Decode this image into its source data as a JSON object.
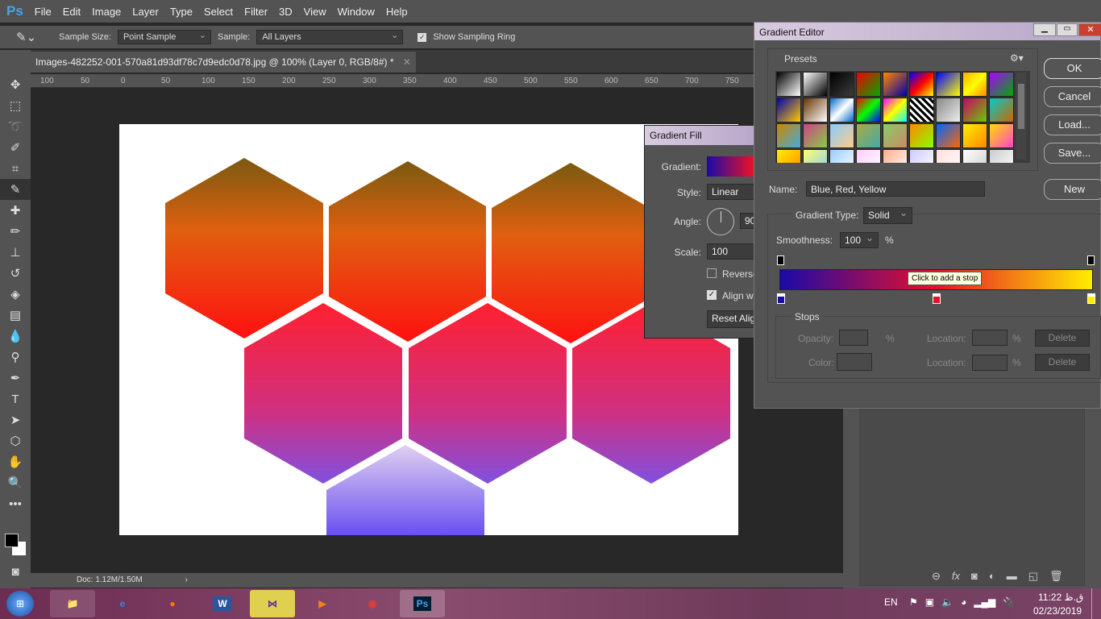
{
  "app": {
    "logo": "Ps",
    "menu": [
      "File",
      "Edit",
      "Image",
      "Layer",
      "Type",
      "Select",
      "Filter",
      "3D",
      "View",
      "Window",
      "Help"
    ]
  },
  "options": {
    "sample_size_label": "Sample Size:",
    "sample_size": "Point Sample",
    "sample_label": "Sample:",
    "sample": "All Layers",
    "show_ring": "Show Sampling Ring",
    "show_ring_checked": true
  },
  "document": {
    "tab": "Images-482252-001-570a81d93df78c7d9edc0d78.jpg @ 100% (Layer 0, RGB/8#) *",
    "ruler": [
      "100",
      "50",
      "0",
      "50",
      "100",
      "150",
      "200",
      "250",
      "300",
      "350",
      "400",
      "450",
      "500",
      "550",
      "600",
      "650",
      "700",
      "750"
    ],
    "status": "Doc: 1.12M/1.50M"
  },
  "gradient_fill": {
    "title": "Gradient Fill",
    "gradient_label": "Gradient:",
    "style_label": "Style:",
    "style": "Linear",
    "angle_label": "Angle:",
    "angle": "90",
    "scale_label": "Scale:",
    "scale": "100",
    "reverse": "Reverse",
    "reverse_checked": false,
    "align": "Align with layer",
    "align_checked": true,
    "reset": "Reset Alignment"
  },
  "gradient_editor": {
    "title": "Gradient Editor",
    "presets_label": "Presets",
    "ok": "OK",
    "cancel": "Cancel",
    "load": "Load...",
    "save": "Save...",
    "name_label": "Name:",
    "name": "Blue, Red, Yellow",
    "new": "New",
    "type_label": "Gradient Type:",
    "type": "Solid",
    "smooth_label": "Smoothness:",
    "smoothness": "100",
    "pct": "%",
    "tooltip": "Click to add a stop",
    "stops_label": "Stops",
    "opacity_label": "Opacity:",
    "location_label": "Location:",
    "delete": "Delete",
    "color_label": "Color:",
    "gradient_colors": [
      "#1a0aa8",
      "#e8102a",
      "#ffee00"
    ]
  },
  "taskbar": {
    "lang": "EN",
    "time": "11:22 ق.ظ",
    "date": "02/23/2019"
  }
}
